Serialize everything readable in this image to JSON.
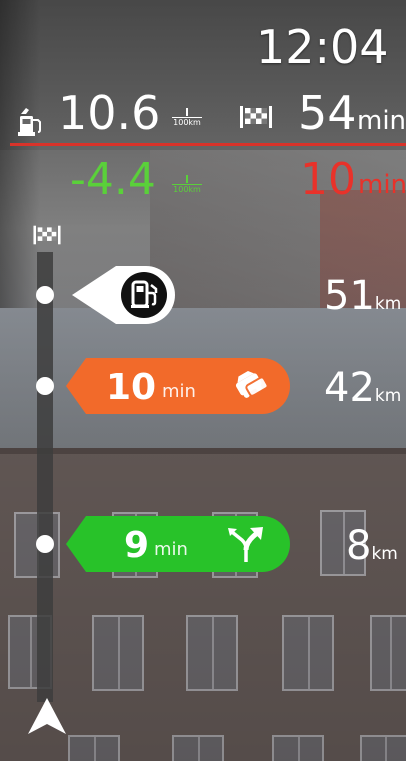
{
  "status": {
    "time": "12:04"
  },
  "fuel": {
    "consumption": "10.6",
    "unit_top": "1",
    "unit_bottom": "100km",
    "difference": "-4.4",
    "icon": "fuel-pump-icon"
  },
  "arrival": {
    "remaining": "54",
    "remaining_unit": "min",
    "delay": "10",
    "delay_unit": "min",
    "icon": "checkered-flag-icon"
  },
  "route_bar": {
    "destination_icon": "checkered-flag-icon",
    "current_position_icon": "navigation-arrow-icon",
    "events": [
      {
        "type": "fuel-station",
        "icon": "fuel-station-icon",
        "distance": "51",
        "distance_unit": "km",
        "color": "#ffffff"
      },
      {
        "type": "traffic",
        "icon": "traffic-jam-icon",
        "delay": "10",
        "delay_unit": "min",
        "distance": "42",
        "distance_unit": "km",
        "color": "#f26a2a"
      },
      {
        "type": "faster-route",
        "icon": "route-split-icon",
        "delay": "9",
        "delay_unit": "min",
        "distance": "8",
        "distance_unit": "km",
        "color": "#28c229"
      }
    ]
  },
  "colors": {
    "accent_red": "#d8332a",
    "fuel_green": "#5ad03a",
    "traffic_orange": "#f26a2a",
    "route_green": "#28c229"
  }
}
